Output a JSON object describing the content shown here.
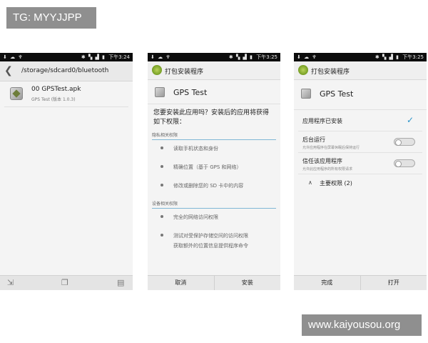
{
  "watermark_top": "TG: MYYJJPP",
  "watermark_bottom": "www.kaiyousou.org",
  "status": {
    "left_icons": "⬇ ☁ ♆",
    "right_icons_1": "✱ ▚ ▟ ▮",
    "time_1": "下午3:24",
    "time_2": "下午3:25",
    "time_3": "下午3:25"
  },
  "phone1": {
    "path": "/storage/sdcard0/bluetooth",
    "file_name": "00 GPSTest.apk",
    "file_sub": "GPS Test (版本 1.0.3)"
  },
  "phone2": {
    "header_title": "打包安装程序",
    "app_name": "GPS Test",
    "question_line1": "您要安装此应用吗？安装后的应用将获得",
    "question_line2": "如下权限：",
    "section_privacy": "隐私相关权限",
    "perms_privacy": [
      "读取手机状态和身份",
      "精确位置（基于 GPS 和网络）",
      "修改或删除您的 SD 卡中的内容"
    ],
    "section_device": "设备相关权限",
    "perm_device_1": "完全的网络访问权限",
    "perm_device_2a": "测试对受保护存储空间的访问权限",
    "perm_device_2b": "获取额外的位置信息提供程序命令",
    "btn_cancel": "取消",
    "btn_install": "安装"
  },
  "phone3": {
    "header_title": "打包安装程序",
    "app_name": "GPS Test",
    "installed_label": "应用程序已安装",
    "bg_title": "后台运行",
    "bg_sub": "允许应用程序在屏幕休眠后保持运行",
    "trust_title": "信任该应用程序",
    "trust_sub": "允许此应用程序的所有权限请求",
    "main_perms": "主要权限 (2)",
    "btn_done": "完成",
    "btn_open": "打开"
  },
  "icons": {
    "back": "back-arrow-icon",
    "check": "checkmark-icon",
    "caret": "caret-up-icon"
  },
  "colors": {
    "accent": "#2b94c9",
    "status_bar": "#0c0c0c"
  }
}
